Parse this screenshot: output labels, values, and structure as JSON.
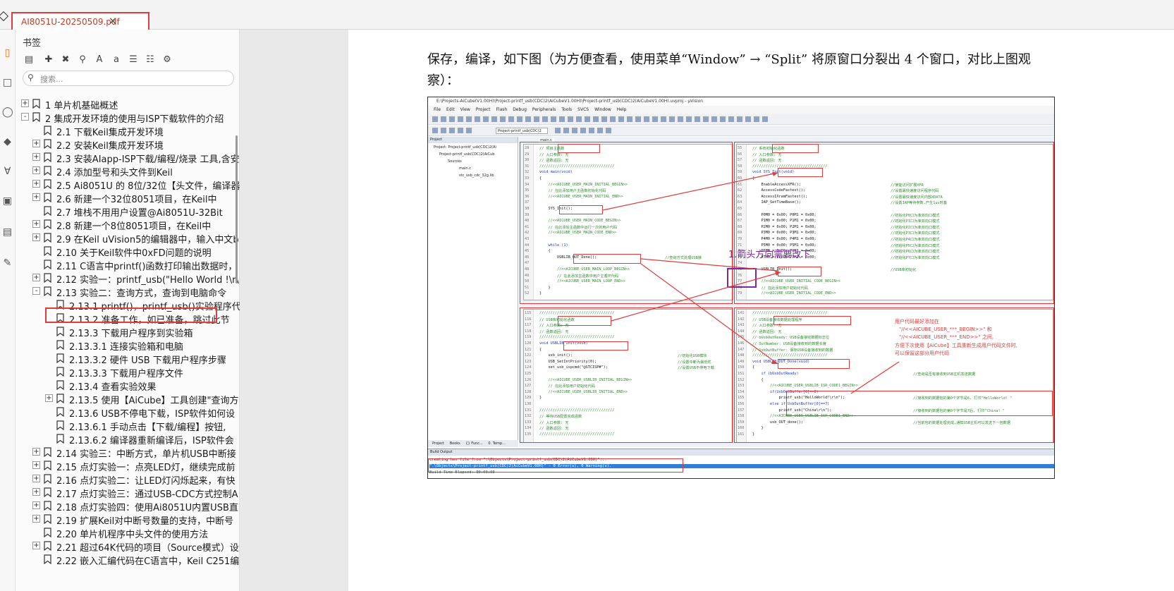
{
  "app": {
    "tab_title": "AI8051U-20250509.pdf",
    "tab_close": "×"
  },
  "rail_icons": [
    "bookmark-icon",
    "page-icon",
    "comment-icon",
    "layers-icon",
    "attachment-icon",
    "lock-icon",
    "chart-icon",
    "sign-icon"
  ],
  "bookmarks_panel": {
    "title": "书签",
    "tool_icons": [
      "outline-icon",
      "add-bookmark-icon",
      "delete-bookmark-icon",
      "find-bookmark-icon",
      "font-larger-icon",
      "font-smaller-icon",
      "expand-all-icon",
      "bookmark-settings-icon"
    ],
    "search_placeholder": "搜索...",
    "items": [
      {
        "label": "1  单片机基础概述",
        "indent": 0,
        "expander": "+"
      },
      {
        "label": "2  集成开发环境的使用与ISP下载软件的介绍",
        "indent": 0,
        "expander": "-"
      },
      {
        "label": "2.1 下载Keil集成开发环境",
        "indent": 1,
        "expander": ""
      },
      {
        "label": "2.2  安装Keil集成开发环境",
        "indent": 1,
        "expander": "+"
      },
      {
        "label": "2.3  安装AIapp-ISP下载/编程/烧录 工具,含安",
        "indent": 1,
        "expander": "+"
      },
      {
        "label": "2.4  添加型号和头文件到Keil",
        "indent": 1,
        "expander": "+"
      },
      {
        "label": "2.5  Ai8051U 的 8位/32位【头文件，编译器",
        "indent": 1,
        "expander": "+"
      },
      {
        "label": "2.6 新建一个32位8051项目，在Keil中",
        "indent": 1,
        "expander": "+"
      },
      {
        "label": "2.7  堆栈不用用户设置@Ai8051U-32Bit",
        "indent": 1,
        "expander": ""
      },
      {
        "label": "2.8  新建一个8位8051项目，在Keil中",
        "indent": 1,
        "expander": "+"
      },
      {
        "label": "2.9  在Keil uVision5的编辑器中，输入中文b",
        "indent": 1,
        "expander": "+"
      },
      {
        "label": "2.10  关于Keil软件中0xFD问题的说明",
        "indent": 1,
        "expander": ""
      },
      {
        "label": "2.11  C语言中printf()函数打印输出数据时，",
        "indent": 1,
        "expander": ""
      },
      {
        "label": "2.12  实验一：printf_usb(\"Hello World !\\r\\n\"",
        "indent": 1,
        "expander": "+"
      },
      {
        "label": "2.13  实验二：查询方式，查询到电脑命令",
        "indent": 1,
        "expander": "-"
      },
      {
        "label": "2.13.1 printf()，printf_usb()实验程序代码",
        "indent": 2,
        "expander": ""
      },
      {
        "label": "2.13.2 准备工作，如已准备，跳过此节",
        "indent": 2,
        "expander": ""
      },
      {
        "label": "2.13.3  下载用户程序到实验箱",
        "indent": 2,
        "expander": ""
      },
      {
        "label": "2.13.3.1 连接实验箱和电脑",
        "indent": 2,
        "expander": ""
      },
      {
        "label": "2.13.3.2 硬件 USB 下载用户程序步骤",
        "indent": 2,
        "expander": ""
      },
      {
        "label": "2.13.3.3 下载用户程序文件",
        "indent": 2,
        "expander": ""
      },
      {
        "label": "2.13.4  查看实验效果",
        "indent": 2,
        "expander": ""
      },
      {
        "label": "2.13.5  使用【AiCube】工具创建\"查询方",
        "indent": 2,
        "expander": "+"
      },
      {
        "label": "2.13.6  USB不停电下载，ISP软件如何设",
        "indent": 2,
        "expander": ""
      },
      {
        "label": "2.13.6.1 手动点击【下载/编程】按钮,",
        "indent": 2,
        "expander": ""
      },
      {
        "label": "2.13.6.2  编译器重新编译后，ISP软件会",
        "indent": 2,
        "expander": ""
      },
      {
        "label": "2.14  实验三：中断方式，单片机USB中断接",
        "indent": 1,
        "expander": "+"
      },
      {
        "label": "2.15  点灯实验一：点亮LED灯，继续完成前",
        "indent": 1,
        "expander": "+"
      },
      {
        "label": "2.16  点灯实验二：让LED灯闪烁起来，有快",
        "indent": 1,
        "expander": "+"
      },
      {
        "label": "2.17  点灯实验三：通过USB-CDC方式控制A",
        "indent": 1,
        "expander": "+"
      },
      {
        "label": "2.18  点灯实验四：使用Ai8051U内置USB直",
        "indent": 1,
        "expander": "+"
      },
      {
        "label": "2.19  扩展Keil对中断号数量的支持，中断号",
        "indent": 1,
        "expander": "+"
      },
      {
        "label": "2.20  单片机程序中头文件的使用方法",
        "indent": 1,
        "expander": ""
      },
      {
        "label": "2.21  超过64K代码的项目（Source模式）设",
        "indent": 1,
        "expander": "+"
      },
      {
        "label": "2.22  嵌入汇编代码在C语言中，Keil C251编",
        "indent": 1,
        "expander": ""
      }
    ]
  },
  "page": {
    "paragraph": "保存，编译，如下图（为方便查看，使用菜单“Window” → “Split” 将原窗口分裂出 4 个窗口，对比上图观察）："
  },
  "figure": {
    "titlebar": "E:\\Projects-AiCube(V1.00H)\\Project-printf_usb(CDC)2(AiCubeV1.00H)\\Project-printf_usb(CDC)2(AiCubeV1.00H).uvproj - µVision",
    "menus": [
      "File",
      "Edit",
      "View",
      "Project",
      "Flash",
      "Debug",
      "Peripherals",
      "Tools",
      "SVCS",
      "Window",
      "Help"
    ],
    "target": "Project-printf_usb(CDC)2",
    "project_header": "Project",
    "project_tree": [
      "Project: Project-printf_usb(CDC)2(Ai",
      "Project-printf_usb(CDC)2(AiCub",
      "Sources",
      "main.c",
      "stc_usb_cdc_32g.lib"
    ],
    "project_tabs": [
      "Project",
      "Books",
      "{} Func...",
      "0. Temp..."
    ],
    "editor_tab": "main.c",
    "pane1": {
      "lines": [
        [
          "28",
          "// 项目主函数"
        ],
        [
          "29",
          "// 入口参数: 无"
        ],
        [
          "30",
          "// 函数返回: 无"
        ],
        [
          "31",
          "//////////////////////////////////"
        ],
        [
          "32",
          "void main(void)"
        ],
        [
          "33",
          "{"
        ],
        [
          "34",
          "    //<<AICUBE_USER_MAIN_INITIAL_BEGIN>>"
        ],
        [
          "35",
          "    // 在此添加用户主函数初始化代码"
        ],
        [
          "36",
          "    //<<AICUBE_USER_MAIN_INITIAL_END>>"
        ],
        [
          "37",
          ""
        ],
        [
          "38",
          "    SYS_Init();"
        ],
        [
          "39",
          ""
        ],
        [
          "40",
          "    //<<AICUBE_USER_MAIN_CODE_BEGIN>>"
        ],
        [
          "41",
          "    // 在此添加主函数中运行一次的用户代码"
        ],
        [
          "42",
          "    //<<AICUBE_USER_MAIN_CODE_END>>"
        ],
        [
          "43",
          ""
        ],
        [
          "44",
          "    while (1)"
        ],
        [
          "45",
          "    {"
        ],
        [
          "46",
          "        USBLIB_OUT_Done();"
        ],
        [
          "47",
          ""
        ],
        [
          "48",
          "        //<<AICUBE_USER_MAIN_LOOP_BEGIN>>"
        ],
        [
          "49",
          "        // 在此添加主函数中用户主循环代码"
        ],
        [
          "50",
          "        //<<AICUBE_USER_MAIN_LOOP_END>>"
        ],
        [
          "51",
          "    }"
        ],
        [
          "52",
          "}"
        ]
      ],
      "comment46": "//查询方式处理USB接"
    },
    "pane2": {
      "lines": [
        [
          "55",
          "// 系统初始化函数"
        ],
        [
          "56",
          "// 入口参数: 无"
        ],
        [
          "57",
          "// 函数返回: 无"
        ],
        [
          "58",
          "//////////////////////////////////"
        ],
        [
          "59",
          "void SYS_Init(void)"
        ],
        [
          "60",
          "{"
        ],
        [
          "61",
          "    EnableAccessXFR();"
        ],
        [
          "62",
          "    AccessCodeFastest();"
        ],
        [
          "63",
          "    AccessIXramFastest();"
        ],
        [
          "64",
          "    IAP_SetTimeBase();"
        ],
        [
          "65",
          ""
        ],
        [
          "66",
          "    P0M0 = 0x00; P0M1 = 0x00;"
        ],
        [
          "67",
          "    P1M0 = 0x00; P1M1 = 0x00;"
        ],
        [
          "68",
          "    P2M0 = 0x00; P2M1 = 0x00;"
        ],
        [
          "69",
          "    P3M0 = 0x00; P3M1 = 0x00;"
        ],
        [
          "70",
          "    P4M0 = 0x00; P4M1 = 0x00;"
        ],
        [
          "71",
          "    P5M0 = 0x00; P5M1 = 0x00;"
        ],
        [
          "72",
          "    P6M0 = 0x00; P6M1 = 0x00;"
        ],
        [
          "73",
          "    P7M0 = 0x00; P7M1 = 0x00;"
        ],
        [
          "74",
          ""
        ],
        [
          "75",
          "    USBLIB_Init();"
        ],
        [
          "76",
          ""
        ],
        [
          "77",
          "    //<<AICUBE_USER_INITIAL_CODE_BEGIN>>"
        ],
        [
          "78",
          "    // 在此添加用户初始化代码"
        ],
        [
          "79",
          "    //<<AICUBE_USER_INITIAL_CODE_END>>"
        ]
      ],
      "comments": [
        "//使能访问扩展XFR",
        "//设置最快速度访问程序代码",
        "//设置最快速度访问内部XDATA",
        "//设置IAP等待参数,产生1us时基",
        "",
        "//初始化P0口为准双向口模式",
        "//初始化P1口为准双向口模式",
        "//初始化P2口为准双向口模式",
        "//初始化P3口为准双向口模式",
        "//初始化P4口为准双向口模式",
        "//初始化P5口为准双向口模式",
        "//初始化P6口为准双向口模式",
        "//初始化P7口为准双向口模式",
        "",
        "//USB库初始化"
      ]
    },
    "pane3": {
      "lines": [
        [
          "115",
          "//////////////////////////////////"
        ],
        [
          "116",
          "// USB库初始化函数"
        ],
        [
          "117",
          "// 入口参数: 无"
        ],
        [
          "118",
          "// 函数返回: 无"
        ],
        [
          "119",
          "//////////////////////////////////"
        ],
        [
          "120",
          "void USBLIB_Init(void)"
        ],
        [
          "121",
          "{"
        ],
        [
          "122",
          "    usb_init();"
        ],
        [
          "123",
          "    USB_SetIntPriority(0);"
        ],
        [
          "124",
          "    set_usb_ispcmd(\"@STCISP#\");"
        ],
        [
          "125",
          ""
        ],
        [
          "126",
          "    //<<AICUBE_USER_USBLIB_INITIAL_BEGIN>>"
        ],
        [
          "127",
          "    // 在此添加用户初始化代码"
        ],
        [
          "128",
          "    //<<AICUBE_USER_USBLIB_INITIAL_END>>"
        ],
        [
          "129",
          "}"
        ],
        [
          "130",
          ""
        ],
        [
          "131",
          "//////////////////////////////////"
        ],
        [
          "132",
          "// 等待USB配置完成函数"
        ],
        [
          "133",
          "// 入口参数: 无"
        ],
        [
          "134",
          "// 函数返回: 无"
        ],
        [
          "135",
          "//////////////////////////////////"
        ]
      ],
      "comments": [
        "//初始化USB模块",
        "//设置中断为最低优",
        "//设置USB不停电下载"
      ]
    },
    "pane4": {
      "lines": [
        [
          "141",
          "//////////////////////////////////"
        ],
        [
          "142",
          "// USB设备接收数据处理程序"
        ],
        [
          "143",
          "// 入口参数: 无"
        ],
        [
          "144",
          "// 函数返回: 无"
        ],
        [
          "145",
          "// bUsbOutReady: USB设备接收数据标志位"
        ],
        [
          "146",
          "// OutNumber: USB设备接收到的数据长度"
        ],
        [
          "147",
          "// UsbOutBuffer: 保存USB设备接收到的数据"
        ],
        [
          "148",
          "//////////////////////////////////"
        ],
        [
          "149",
          "void USBLIB_OUT_Done(void)"
        ],
        [
          "150",
          "{"
        ],
        [
          "151",
          "    if (bUsbOutReady)"
        ],
        [
          "152",
          "    {"
        ],
        [
          "153",
          "        //<<AICUBE_USER_USBLIB_ISR_CODE1_BEGIN>>"
        ],
        [
          "154",
          "        if(UsbOutBuffer[0]==6)"
        ],
        [
          "155",
          "            printf_usb(\"HelloWorld!\\r\\n\");"
        ],
        [
          "156",
          "        else if(UsbOutBuffer[0]==7)"
        ],
        [
          "157",
          "            printf_usb(\"China\\r\\n\");"
        ],
        [
          "158",
          "        //<<AICUBE_USER_USBLIB_ISR_CODE1_END>>"
        ],
        [
          "159",
          "        usb_OUT_done();"
        ],
        [
          "160",
          "    }"
        ],
        [
          "161",
          "}"
        ]
      ],
      "comments": [
        "//查询是否有接收到USB主机发送数据",
        "//接收到的数据包的第0个字节是6, 打印\"HelloWorld! \"",
        "//接收到的数据包的第0个字节是7后, 打印\"China! \"",
        "//当前包的数据处理完成,通知USB主机可以发送下一包数据"
      ]
    },
    "annotations": {
      "purple": "1.箭头方向需要改下",
      "red_lines": [
        "用户代码最好添加在",
        "\"//<<AICUBE_USER_***_BEGIN>>\" 和",
        "\"//<<AICUBE_USER_***_END>>\" 之间,",
        "方便下次使用【AiCube】工具重新生成用户代码文件时,",
        "可以保留这部分用户代码"
      ]
    },
    "output": {
      "header": "Build Output",
      "lines": [
        "creating hex file from \".\\Objects\\Project-printf_usb(CDC)2(AiCubeV1.00H)\"...",
        "\".\\Objects\\Project-printf_usb(CDC)2(AiCubeV1.00H)\" - 0 Error(s), 0 Warning(s).",
        "Build Time Elapsed:  00:00:00"
      ]
    }
  }
}
